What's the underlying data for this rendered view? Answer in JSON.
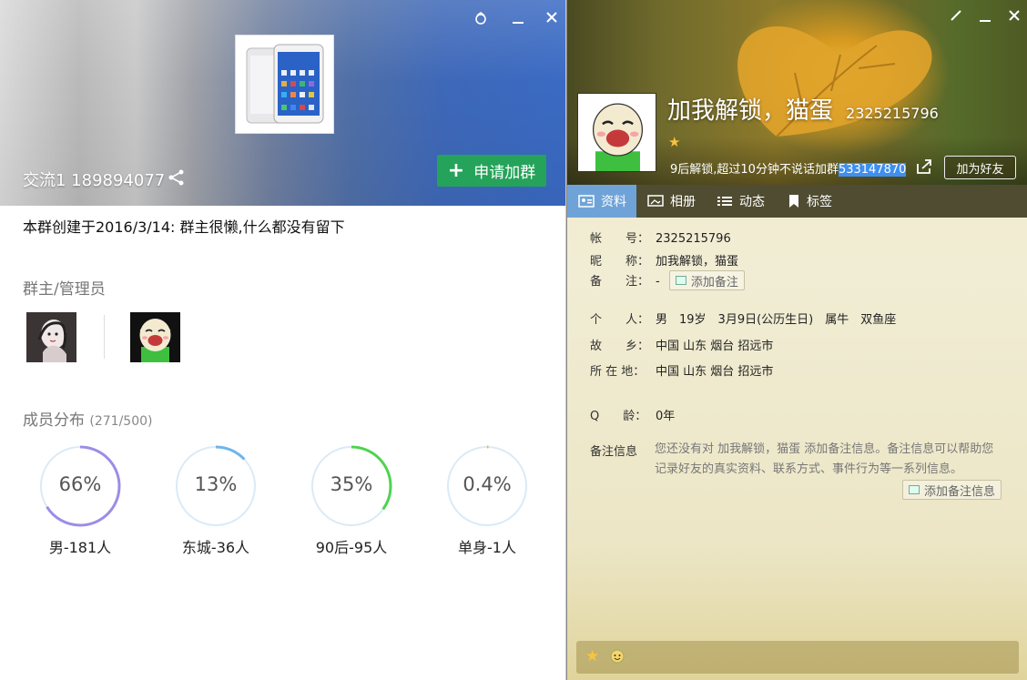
{
  "group": {
    "title": "交流1 189894077",
    "join_button": "申请加群",
    "description": "本群创建于2016/3/14:  群主很懒,什么都没有留下",
    "admins_heading": "群主/管理员",
    "members_heading": "成员分布",
    "members_count": "(271/500)",
    "stats": [
      {
        "percent_label": "66%",
        "value": 0.66,
        "label": "男-181人",
        "color": "#9d8ce8"
      },
      {
        "percent_label": "13%",
        "value": 0.13,
        "label": "东城-36人",
        "color": "#6fb6ea"
      },
      {
        "percent_label": "35%",
        "value": 0.35,
        "label": "90后-95人",
        "color": "#4fd34f"
      },
      {
        "percent_label": "0.4%",
        "value": 0.004,
        "label": "单身-1人",
        "color": "#f0b64a"
      }
    ]
  },
  "profile": {
    "nickname": "加我解锁，猫蛋",
    "qq": "2325215796",
    "signature_prefix": "9后解锁,超过10分钟不说话加群",
    "signature_highlight": "533147870",
    "add_friend": "加为好友",
    "tabs": [
      {
        "label": "资料",
        "icon": "profile-card-icon"
      },
      {
        "label": "相册",
        "icon": "photo-album-icon"
      },
      {
        "label": "动态",
        "icon": "feed-list-icon"
      },
      {
        "label": "标签",
        "icon": "bookmark-tag-icon"
      }
    ],
    "fields": {
      "account_key": "帐　　号：",
      "account_val": "2325215796",
      "nick_key": "昵　　称：",
      "nick_val": "加我解锁，猫蛋",
      "memo_key": "备　　注：",
      "memo_val": "-",
      "memo_btn": "添加备注",
      "person_key": "个　　人：",
      "person_val": "男　19岁　3月9日(公历生日)　属牛　双鱼座",
      "hometown_key": "故　　乡：",
      "hometown_val": "中国 山东 烟台 招远市",
      "location_key": "所 在 地：",
      "location_val": "中国 山东 烟台 招远市",
      "qage_key": "Q　　龄：",
      "qage_val": "0年"
    },
    "note_heading": "备注信息",
    "note_text": "您还没有对 加我解锁，猫蛋 添加备注信息。备注信息可以帮助您记录好友的真实资料、联系方式、事件行为等一系列信息。",
    "note_button": "添加备注信息"
  }
}
